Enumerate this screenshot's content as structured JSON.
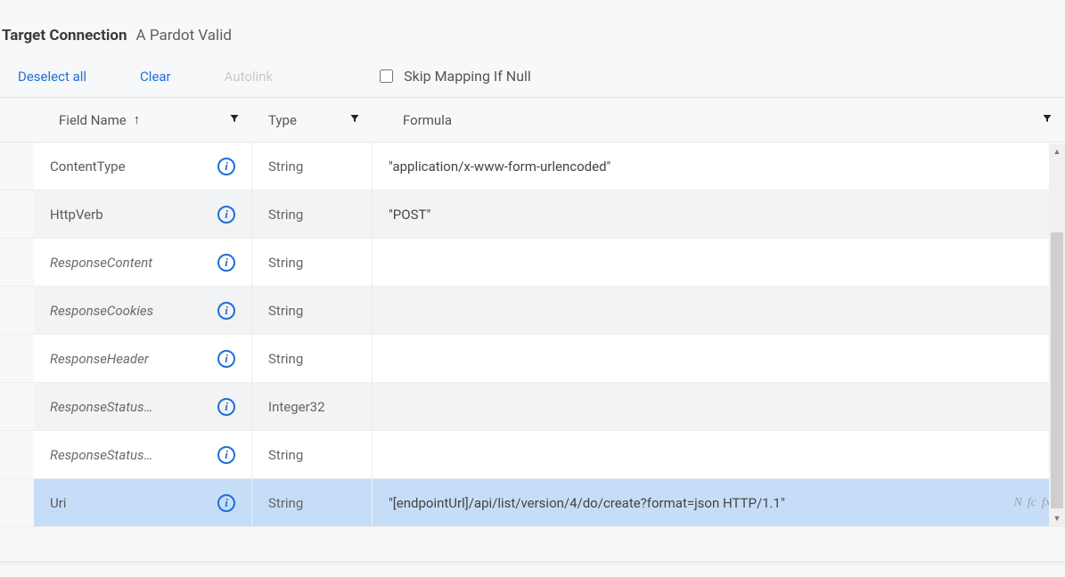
{
  "header": {
    "label": "Target Connection",
    "value": "A Pardot Valid"
  },
  "actions": {
    "deselect": "Deselect all",
    "clear": "Clear",
    "autolink": "Autolink",
    "skip_label": "Skip Mapping If Null",
    "skip_checked": false
  },
  "columns": {
    "field_name": "Field Name",
    "type": "Type",
    "formula": "Formula"
  },
  "rows": [
    {
      "name": "ContentType",
      "italic": false,
      "type": "String",
      "formula": "\"application/x-www-form-urlencoded\"",
      "alt": false,
      "selected": false,
      "show_fx": false
    },
    {
      "name": "HttpVerb",
      "italic": false,
      "type": "String",
      "formula": "\"POST\"",
      "alt": true,
      "selected": false,
      "show_fx": false
    },
    {
      "name": "ResponseContent",
      "italic": true,
      "type": "String",
      "formula": "",
      "alt": false,
      "selected": false,
      "show_fx": false
    },
    {
      "name": "ResponseCookies",
      "italic": true,
      "type": "String",
      "formula": "",
      "alt": true,
      "selected": false,
      "show_fx": false
    },
    {
      "name": "ResponseHeader",
      "italic": true,
      "type": "String",
      "formula": "",
      "alt": false,
      "selected": false,
      "show_fx": false
    },
    {
      "name": "ResponseStatus…",
      "italic": true,
      "type": "Integer32",
      "formula": "",
      "alt": true,
      "selected": false,
      "show_fx": false
    },
    {
      "name": "ResponseStatus…",
      "italic": true,
      "type": "String",
      "formula": "",
      "alt": false,
      "selected": false,
      "show_fx": false
    },
    {
      "name": "Uri",
      "italic": false,
      "type": "String",
      "formula": "\"[endpointUrl]/api/list/version/4/do/create?format=json HTTP/1.1\"",
      "alt": true,
      "selected": true,
      "show_fx": true
    }
  ],
  "fx_icons": {
    "n": "N",
    "fc": "fc",
    "fx": "fx"
  }
}
